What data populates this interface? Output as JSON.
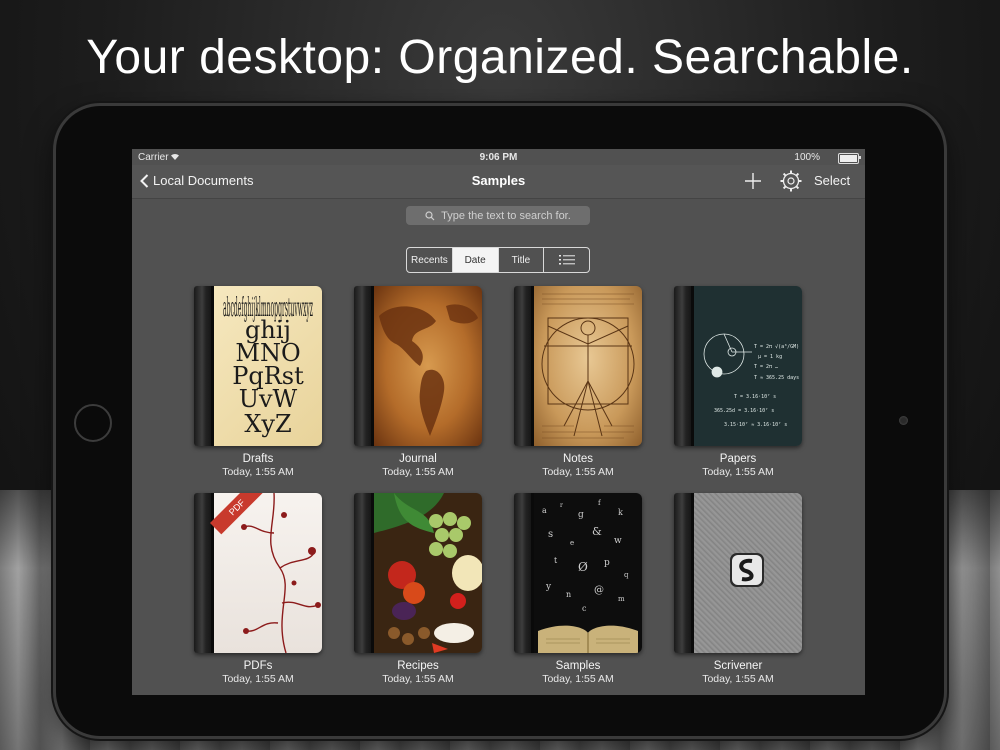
{
  "headline": "Your desktop: Organized. Searchable.",
  "status": {
    "carrier": "Carrier",
    "time": "9:06 PM",
    "battery": "100%"
  },
  "navbar": {
    "back_label": "Local Documents",
    "title": "Samples",
    "select_label": "Select"
  },
  "search": {
    "placeholder": "Type the text to search for."
  },
  "sort": {
    "options": [
      "Recents",
      "Date",
      "Title"
    ],
    "selected": "Date"
  },
  "books": [
    {
      "title": "Drafts",
      "date": "Today, 1:55 AM",
      "cover": "typography"
    },
    {
      "title": "Journal",
      "date": "Today, 1:55 AM",
      "cover": "world-map"
    },
    {
      "title": "Notes",
      "date": "Today, 1:55 AM",
      "cover": "vitruvian-sketch"
    },
    {
      "title": "Papers",
      "date": "Today, 1:55 AM",
      "cover": "chalkboard-formulas"
    },
    {
      "title": "PDFs",
      "date": "Today, 1:55 AM",
      "cover": "floral-pdf",
      "badge": "PDF"
    },
    {
      "title": "Recipes",
      "date": "Today, 1:55 AM",
      "cover": "fruits"
    },
    {
      "title": "Samples",
      "date": "Today, 1:55 AM",
      "cover": "flying-letters"
    },
    {
      "title": "Scrivener",
      "date": "Today, 1:55 AM",
      "cover": "gray-cloth"
    }
  ],
  "drafts_cover_text": "abcdefghijklmnopqrstuvwxyz"
}
